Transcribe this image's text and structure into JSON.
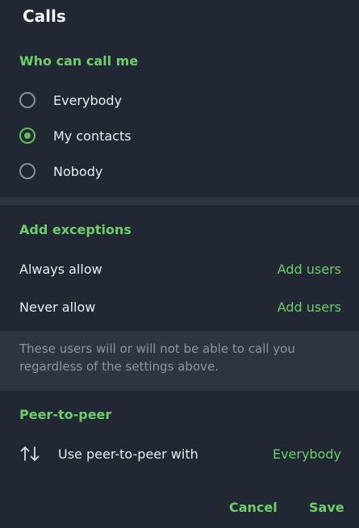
{
  "dialog": {
    "title": "Calls"
  },
  "who_can_call": {
    "heading": "Who can call me",
    "options": [
      {
        "label": "Everybody",
        "selected": false
      },
      {
        "label": "My contacts",
        "selected": true
      },
      {
        "label": "Nobody",
        "selected": false
      }
    ]
  },
  "exceptions": {
    "heading": "Add exceptions",
    "always_allow": {
      "label": "Always allow",
      "action": "Add users"
    },
    "never_allow": {
      "label": "Never allow",
      "action": "Add users"
    },
    "info": "These users will or will not be able to call you regardless of the settings above."
  },
  "peer_to_peer": {
    "heading": "Peer-to-peer",
    "label": "Use peer-to-peer with",
    "value": "Everybody",
    "icon": "arrows-up-down-icon"
  },
  "buttons": {
    "cancel": "Cancel",
    "save": "Save"
  },
  "colors": {
    "background": "#212733",
    "accent": "#6ecf6a",
    "section_separator": "#2c3541",
    "muted_text": "#8d96a0"
  }
}
